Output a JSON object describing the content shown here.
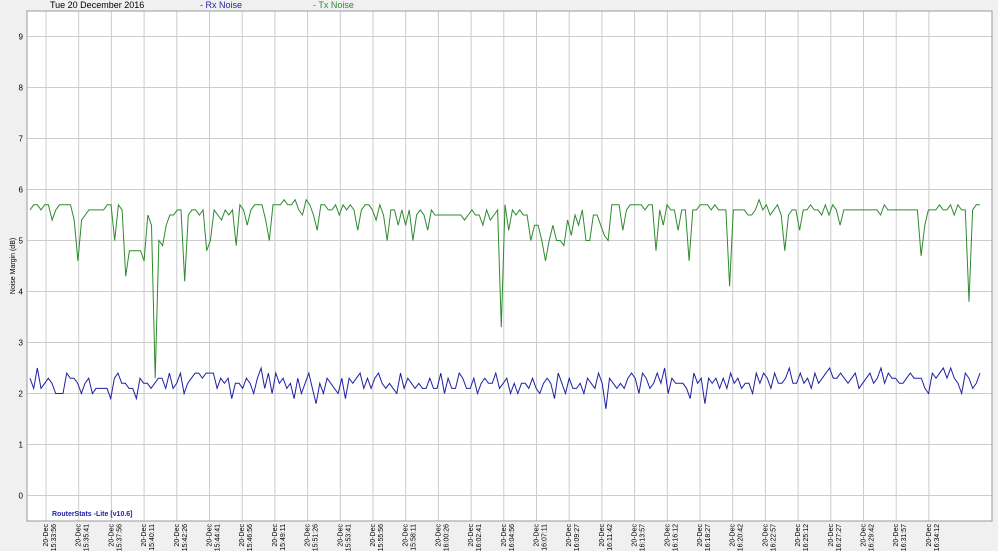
{
  "header": {
    "date": "Tue 20 December 2016",
    "rx_legend": "- Rx Noise",
    "tx_legend": "- Tx Noise"
  },
  "watermark": "RouterStats -Lite [v10.6]",
  "colors": {
    "rx": "#1f1fa6",
    "tx": "#2e8b2e",
    "grid": "#cccccc",
    "plot_bg": "#ffffff"
  },
  "chart_data": {
    "type": "line",
    "ylabel": "Noise Margin (dB)",
    "xlabel": "",
    "ylim": [
      -0.5,
      9.5
    ],
    "yticks": [
      0,
      1,
      2,
      3,
      4,
      5,
      6,
      7,
      8,
      9
    ],
    "grid": true,
    "legend_placement": "top",
    "x_tick_labels": [
      "20-Dec 15:33:56",
      "20-Dec 15:35:41",
      "20-Dec 15:37:56",
      "20-Dec 15:40:11",
      "20-Dec 15:42:26",
      "20-Dec 15:44:41",
      "20-Dec 15:46:56",
      "20-Dec 15:49:11",
      "20-Dec 15:51:26",
      "20-Dec 15:53:41",
      "20-Dec 15:55:56",
      "20-Dec 15:58:11",
      "20-Dec 16:00:26",
      "20-Dec 16:02:41",
      "20-Dec 16:04:56",
      "20-Dec 16:07:11",
      "20-Dec 16:09:27",
      "20-Dec 16:11:42",
      "20-Dec 16:13:57",
      "20-Dec 16:16:12",
      "20-Dec 16:18:27",
      "20-Dec 16:20:42",
      "20-Dec 16:22:57",
      "20-Dec 16:25:12",
      "20-Dec 16:27:27",
      "20-Dec 16:29:42",
      "20-Dec 16:31:57",
      "20-Dec 16:34:12"
    ],
    "series": [
      {
        "name": "Tx Noise",
        "values": [
          5.6,
          5.7,
          5.7,
          5.6,
          5.7,
          5.7,
          5.4,
          5.6,
          5.7,
          5.7,
          5.7,
          5.7,
          5.4,
          4.6,
          5.4,
          5.5,
          5.6,
          5.6,
          5.6,
          5.6,
          5.6,
          5.7,
          5.7,
          5.0,
          5.7,
          5.6,
          4.3,
          4.8,
          4.8,
          4.8,
          4.8,
          4.6,
          5.5,
          5.3,
          2.3,
          5.0,
          4.9,
          5.3,
          5.5,
          5.5,
          5.6,
          5.6,
          4.2,
          5.5,
          5.6,
          5.6,
          5.5,
          5.6,
          4.8,
          5.0,
          5.6,
          5.5,
          5.4,
          5.6,
          5.5,
          5.6,
          4.9,
          5.7,
          5.6,
          5.3,
          5.6,
          5.7,
          5.7,
          5.7,
          5.4,
          5.0,
          5.7,
          5.7,
          5.7,
          5.8,
          5.7,
          5.7,
          5.8,
          5.6,
          5.5,
          5.8,
          5.7,
          5.5,
          5.2,
          5.7,
          5.7,
          5.6,
          5.6,
          5.7,
          5.5,
          5.7,
          5.6,
          5.7,
          5.6,
          5.2,
          5.6,
          5.7,
          5.7,
          5.6,
          5.4,
          5.7,
          5.5,
          5.0,
          5.6,
          5.6,
          5.3,
          5.6,
          5.3,
          5.6,
          5.0,
          5.5,
          5.6,
          5.5,
          5.2,
          5.6,
          5.5,
          5.5,
          5.5,
          5.5,
          5.5,
          5.5,
          5.5,
          5.5,
          5.4,
          5.5,
          5.6,
          5.5,
          5.5,
          5.3,
          5.6,
          5.4,
          5.5,
          5.6,
          3.3,
          5.7,
          5.2,
          5.6,
          5.5,
          5.6,
          5.5,
          5.5,
          5.0,
          5.3,
          5.3,
          5.0,
          4.6,
          5.0,
          5.3,
          5.0,
          5.0,
          4.9,
          5.4,
          5.1,
          5.5,
          5.3,
          5.6,
          5.0,
          5.0,
          5.5,
          5.5,
          5.3,
          5.1,
          5.0,
          5.7,
          5.7,
          5.7,
          5.2,
          5.6,
          5.7,
          5.7,
          5.7,
          5.7,
          5.6,
          5.7,
          5.7,
          4.8,
          5.6,
          5.3,
          5.7,
          5.6,
          5.6,
          5.2,
          5.6,
          5.6,
          4.6,
          5.6,
          5.6,
          5.7,
          5.7,
          5.7,
          5.6,
          5.7,
          5.6,
          5.6,
          5.6,
          4.1,
          5.6,
          5.6,
          5.6,
          5.6,
          5.5,
          5.5,
          5.6,
          5.8,
          5.6,
          5.7,
          5.5,
          5.6,
          5.7,
          5.5,
          4.8,
          5.5,
          5.6,
          5.6,
          5.2,
          5.6,
          5.6,
          5.7,
          5.6,
          5.6,
          5.5,
          5.7,
          5.5,
          5.7,
          5.6,
          5.3,
          5.6,
          5.6,
          5.6,
          5.6,
          5.6,
          5.6,
          5.6,
          5.6,
          5.6,
          5.6,
          5.5,
          5.7,
          5.6,
          5.6,
          5.6,
          5.6,
          5.6,
          5.6,
          5.6,
          5.6,
          5.6,
          4.7,
          5.3,
          5.6,
          5.6,
          5.6,
          5.7,
          5.6,
          5.6,
          5.7,
          5.5,
          5.7,
          5.6,
          5.6,
          3.8,
          5.6,
          5.7,
          5.7
        ]
      },
      {
        "name": "Rx Noise",
        "values": [
          2.3,
          2.1,
          2.5,
          2.1,
          2.2,
          2.3,
          2.2,
          2.0,
          2.0,
          2.0,
          2.4,
          2.3,
          2.3,
          2.2,
          2.0,
          2.2,
          2.3,
          2.0,
          2.1,
          2.1,
          2.1,
          2.1,
          1.9,
          2.3,
          2.4,
          2.2,
          2.2,
          2.1,
          2.1,
          1.9,
          2.3,
          2.2,
          2.2,
          2.1,
          2.2,
          2.3,
          2.3,
          2.1,
          2.4,
          2.1,
          2.2,
          2.4,
          2.0,
          2.2,
          2.3,
          2.4,
          2.4,
          2.3,
          2.4,
          2.4,
          2.4,
          2.1,
          2.3,
          2.2,
          2.3,
          1.9,
          2.2,
          2.2,
          2.1,
          2.3,
          2.2,
          2.0,
          2.3,
          2.5,
          2.1,
          2.4,
          2.0,
          2.4,
          2.2,
          2.3,
          2.1,
          2.2,
          1.9,
          2.3,
          2.0,
          2.2,
          2.4,
          2.1,
          1.8,
          2.2,
          2.0,
          2.3,
          2.2,
          2.1,
          2.0,
          2.3,
          1.9,
          2.3,
          2.2,
          2.3,
          2.4,
          2.1,
          2.3,
          2.1,
          2.3,
          2.4,
          2.2,
          2.1,
          2.2,
          2.1,
          2.0,
          2.4,
          2.1,
          2.3,
          2.2,
          2.1,
          2.2,
          2.1,
          2.1,
          2.3,
          2.1,
          2.1,
          2.4,
          2.0,
          2.3,
          2.1,
          2.1,
          2.4,
          2.3,
          2.1,
          2.1,
          2.3,
          2.0,
          2.2,
          2.3,
          2.2,
          2.2,
          2.4,
          2.1,
          2.2,
          2.3,
          2.0,
          2.2,
          2.0,
          2.2,
          2.2,
          2.1,
          2.3,
          2.1,
          2.0,
          2.2,
          2.3,
          2.2,
          1.9,
          2.4,
          2.2,
          2.0,
          2.3,
          2.1,
          2.1,
          2.2,
          2.0,
          2.3,
          2.2,
          2.1,
          2.4,
          2.2,
          1.7,
          2.3,
          2.2,
          2.1,
          2.2,
          2.1,
          2.3,
          2.4,
          2.3,
          2.0,
          2.4,
          2.3,
          2.1,
          2.2,
          2.4,
          2.2,
          2.5,
          2.0,
          2.3,
          2.2,
          2.2,
          2.2,
          2.1,
          1.9,
          2.4,
          2.2,
          2.3,
          1.8,
          2.3,
          2.2,
          2.3,
          2.1,
          2.3,
          2.1,
          2.4,
          2.2,
          2.3,
          2.1,
          2.2,
          2.2,
          2.0,
          2.4,
          2.2,
          2.4,
          2.3,
          2.1,
          2.4,
          2.2,
          2.2,
          2.3,
          2.5,
          2.2,
          2.2,
          2.4,
          2.2,
          2.3,
          2.1,
          2.4,
          2.2,
          2.3,
          2.4,
          2.5,
          2.3,
          2.3,
          2.4,
          2.3,
          2.2,
          2.3,
          2.4,
          2.1,
          2.2,
          2.3,
          2.4,
          2.2,
          2.3,
          2.5,
          2.2,
          2.4,
          2.3,
          2.3,
          2.2,
          2.2,
          2.3,
          2.4,
          2.3,
          2.3,
          2.3,
          2.1,
          2.0,
          2.4,
          2.3,
          2.4,
          2.5,
          2.3,
          2.5,
          2.3,
          2.2,
          2.0,
          2.4,
          2.3,
          2.1,
          2.2,
          2.4
        ]
      }
    ]
  }
}
